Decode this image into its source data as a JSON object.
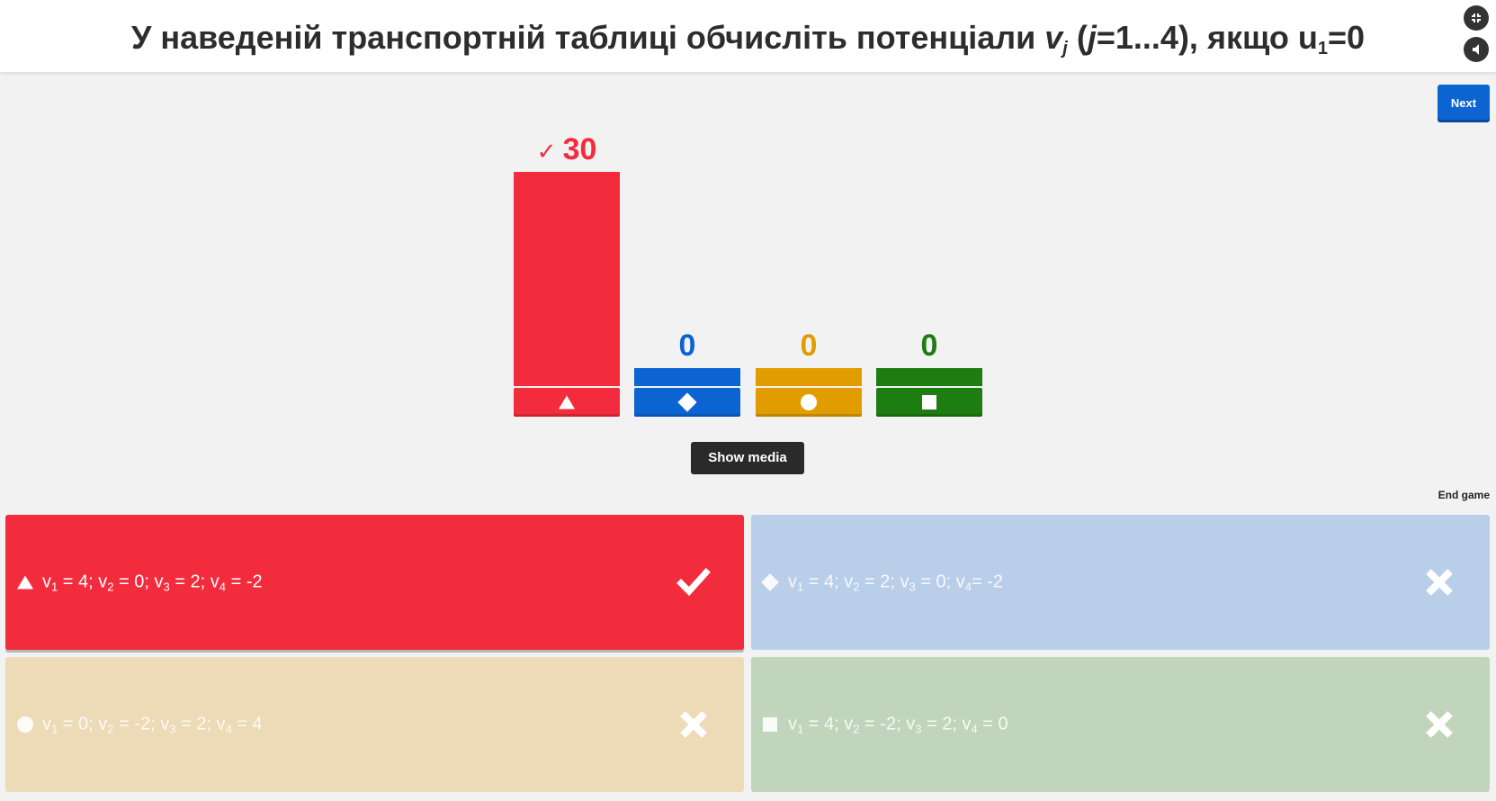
{
  "question": {
    "part1": "У наведеній транспортній таблиці обчисліть потенціали ",
    "var_v": "v",
    "var_v_sub": "j",
    "paren_open": " (",
    "var_j": "j",
    "range": "=1...4), якщо u",
    "u_sub": "1",
    "tail": "=0"
  },
  "controls": {
    "next_label": "Next",
    "show_media_label": "Show media",
    "end_game_label": "End game"
  },
  "colors": {
    "red": "#f22c3d",
    "blue": "#0b64d2",
    "yellow": "#e19d00",
    "green": "#1e7d10"
  },
  "results": {
    "correct_mark": "✓",
    "bars": [
      {
        "color": "red",
        "shape": "triangle-icon",
        "count": "30",
        "correct": true
      },
      {
        "color": "blue",
        "shape": "diamond-icon",
        "count": "0",
        "correct": false
      },
      {
        "color": "yellow",
        "shape": "circle-icon",
        "count": "0",
        "correct": false
      },
      {
        "color": "green",
        "shape": "square-icon",
        "count": "0",
        "correct": false
      }
    ]
  },
  "answers": [
    {
      "shape": "triangle-icon",
      "correct": true,
      "parts": [
        [
          "v",
          "1",
          " = 4; "
        ],
        [
          "v",
          "2",
          " = 0; "
        ],
        [
          "v",
          "3",
          " = 2; "
        ],
        [
          "v",
          "4",
          " = -2"
        ]
      ]
    },
    {
      "shape": "diamond-icon",
      "correct": false,
      "parts": [
        [
          "v",
          "1",
          " = 4; "
        ],
        [
          "v",
          "2",
          " = 2; "
        ],
        [
          "v",
          "3",
          " = 0; "
        ],
        [
          "v",
          "4",
          "= -2"
        ]
      ]
    },
    {
      "shape": "circle-icon",
      "correct": false,
      "parts": [
        [
          "v",
          "1",
          " = 0; "
        ],
        [
          "v",
          "2",
          " = -2; "
        ],
        [
          "v",
          "3",
          " = 2; "
        ],
        [
          "v",
          "4",
          " = 4"
        ]
      ]
    },
    {
      "shape": "square-icon",
      "correct": false,
      "parts": [
        [
          "v",
          "1",
          " = 4; "
        ],
        [
          "v",
          "2",
          " = -2; "
        ],
        [
          "v",
          "3",
          " = 2; "
        ],
        [
          "v",
          "4",
          " = 0"
        ]
      ]
    }
  ]
}
